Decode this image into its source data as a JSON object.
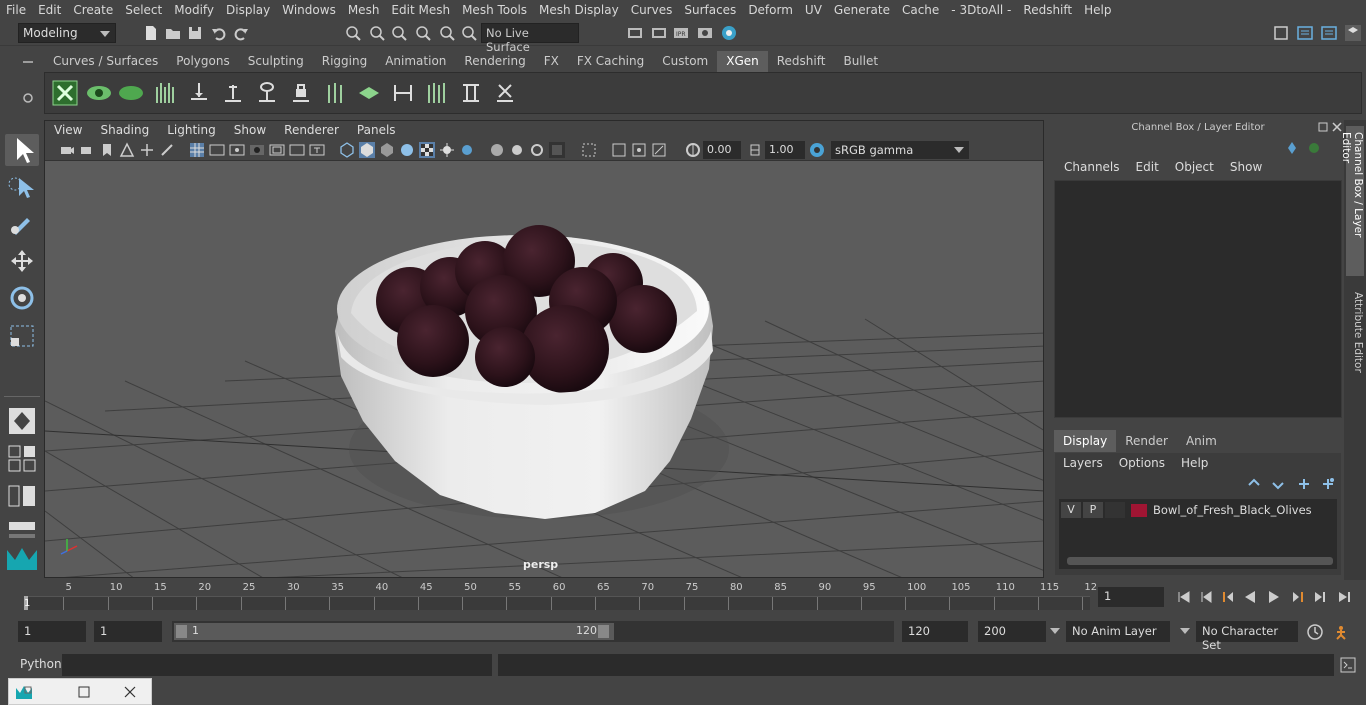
{
  "menubar": [
    "File",
    "Edit",
    "Create",
    "Select",
    "Modify",
    "Display",
    "Windows",
    "Mesh",
    "Edit Mesh",
    "Mesh Tools",
    "Mesh Display",
    "Curves",
    "Surfaces",
    "Deform",
    "UV",
    "Generate",
    "Cache",
    "- 3DtoAll -",
    "Redshift",
    "Help"
  ],
  "status": {
    "mode": "Modeling",
    "live_surface": "No Live Surface"
  },
  "shelf_tabs": [
    {
      "label": "Curves / Surfaces",
      "active": false
    },
    {
      "label": "Polygons",
      "active": false
    },
    {
      "label": "Sculpting",
      "active": false
    },
    {
      "label": "Rigging",
      "active": false
    },
    {
      "label": "Animation",
      "active": false
    },
    {
      "label": "Rendering",
      "active": false
    },
    {
      "label": "FX",
      "active": false
    },
    {
      "label": "FX Caching",
      "active": false
    },
    {
      "label": "Custom",
      "active": false
    },
    {
      "label": "XGen",
      "active": true
    },
    {
      "label": "Redshift",
      "active": false
    },
    {
      "label": "Bullet",
      "active": false
    }
  ],
  "viewport": {
    "menu": [
      "View",
      "Shading",
      "Lighting",
      "Show",
      "Renderer",
      "Panels"
    ],
    "exposure": "0.00",
    "gamma_value": "1.00",
    "color_space": "sRGB gamma",
    "camera_label": "persp"
  },
  "channel_box": {
    "title": "Channel Box / Layer Editor",
    "menu": [
      "Channels",
      "Edit",
      "Object",
      "Show"
    ],
    "layer_tabs": [
      {
        "label": "Display",
        "active": true
      },
      {
        "label": "Render",
        "active": false
      },
      {
        "label": "Anim",
        "active": false
      }
    ],
    "layer_menu": [
      "Layers",
      "Options",
      "Help"
    ],
    "layer": {
      "v": "V",
      "p": "P",
      "name": "Bowl_of_Fresh_Black_Olives",
      "color": "#a01533"
    }
  },
  "side_tabs": [
    "Channel Box / Layer Editor",
    "Attribute Editor"
  ],
  "timeline": {
    "labels": [
      "5",
      "10",
      "15",
      "20",
      "25",
      "30",
      "35",
      "40",
      "45",
      "50",
      "55",
      "60",
      "65",
      "70",
      "75",
      "80",
      "85",
      "90",
      "95",
      "100",
      "105",
      "110",
      "115",
      "12"
    ],
    "current_frame": "1",
    "start_marker": "1"
  },
  "range": {
    "start": "1",
    "playback_start": "1",
    "slider_start": "1",
    "slider_end": "120",
    "playback_end": "120",
    "end": "200",
    "anim_layer": "No Anim Layer",
    "character_set": "No Character Set"
  },
  "cmd": {
    "label": "Python"
  },
  "colors": {
    "bg": "#444444",
    "viewport": "#5c5c5c",
    "accent": "#5d5d5d",
    "olive": "#3a1a22",
    "bowl": "#e9e9e9"
  }
}
